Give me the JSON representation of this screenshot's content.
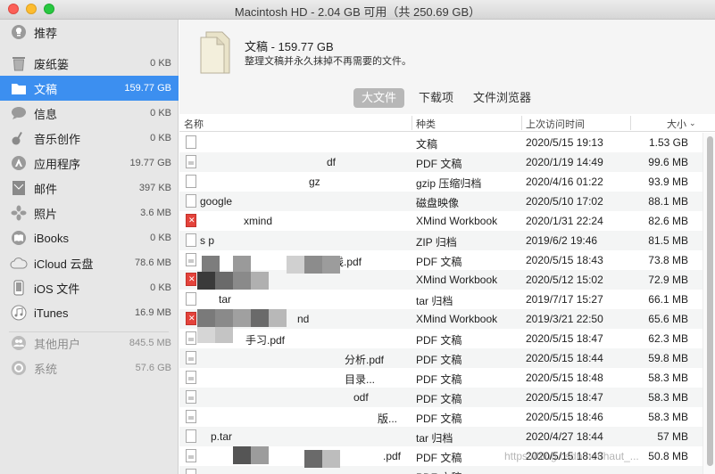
{
  "window": {
    "title": "Macintosh HD - 2.04 GB 可用（共 250.69 GB）"
  },
  "sidebar": {
    "items": [
      {
        "label": "推荐",
        "size": "",
        "icon": "lightbulb-icon"
      },
      {
        "label": "废纸篓",
        "size": "0 KB",
        "icon": "trash-icon"
      },
      {
        "label": "文稿",
        "size": "159.77 GB",
        "icon": "folder-icon",
        "selected": true
      },
      {
        "label": "信息",
        "size": "0 KB",
        "icon": "messages-icon"
      },
      {
        "label": "音乐创作",
        "size": "0 KB",
        "icon": "guitar-icon"
      },
      {
        "label": "应用程序",
        "size": "19.77 GB",
        "icon": "apps-icon"
      },
      {
        "label": "邮件",
        "size": "397 KB",
        "icon": "mail-icon"
      },
      {
        "label": "照片",
        "size": "3.6 MB",
        "icon": "photos-icon"
      },
      {
        "label": "iBooks",
        "size": "0 KB",
        "icon": "book-icon"
      },
      {
        "label": "iCloud 云盘",
        "size": "78.6 MB",
        "icon": "cloud-icon"
      },
      {
        "label": "iOS 文件",
        "size": "0 KB",
        "icon": "phone-icon"
      },
      {
        "label": "iTunes",
        "size": "16.9 MB",
        "icon": "music-icon"
      },
      {
        "label": "其他用户",
        "size": "845.5 MB",
        "icon": "users-icon",
        "dim": true
      },
      {
        "label": "系统",
        "size": "57.6 GB",
        "icon": "gear-icon",
        "dim": true
      }
    ]
  },
  "header": {
    "title": "文稿 - 159.77 GB",
    "description": "整理文稿并永久抹掉不再需要的文件。"
  },
  "tabs": [
    {
      "label": "大文件",
      "active": true
    },
    {
      "label": "下载项",
      "active": false
    },
    {
      "label": "文件浏览器",
      "active": false
    }
  ],
  "columns": {
    "name": "名称",
    "kind": "种类",
    "last_opened": "上次访问时间",
    "size": "大小"
  },
  "files": [
    {
      "name": "",
      "kind": "文稿",
      "date": "2020/5/15 19:13",
      "size": "1.53 GB",
      "icon": "doc"
    },
    {
      "name": "df",
      "kind": "PDF 文稿",
      "date": "2020/1/19 14:49",
      "size": "99.6 MB",
      "icon": "pdf"
    },
    {
      "name": "gz",
      "kind": "gzip 压缩归档",
      "date": "2020/4/16 01:22",
      "size": "93.9 MB",
      "icon": "doc"
    },
    {
      "name": "google",
      "kind": "磁盘映像",
      "date": "2020/5/10 17:02",
      "size": "88.1 MB",
      "icon": "doc"
    },
    {
      "name": "xmind",
      "kind": "XMind Workbook",
      "date": "2020/1/31 22:24",
      "size": "82.6 MB",
      "icon": "xmind"
    },
    {
      "name": "s p",
      "kind": "ZIP 归档",
      "date": "2019/6/2 19:46",
      "size": "81.5 MB",
      "icon": "doc"
    },
    {
      "name": "践.pdf",
      "kind": "PDF 文稿",
      "date": "2020/5/15 18:43",
      "size": "73.8 MB",
      "icon": "pdf"
    },
    {
      "name": "",
      "kind": "XMind Workbook",
      "date": "2020/5/12 15:02",
      "size": "72.9 MB",
      "icon": "xmind"
    },
    {
      "name": "tar",
      "kind": "tar 归档",
      "date": "2019/7/17 15:27",
      "size": "66.1 MB",
      "icon": "doc"
    },
    {
      "name": "nd",
      "kind": "XMind Workbook",
      "date": "2019/3/21 22:50",
      "size": "65.6 MB",
      "icon": "xmind"
    },
    {
      "name": "手习.pdf",
      "kind": "PDF 文稿",
      "date": "2020/5/15 18:47",
      "size": "62.3 MB",
      "icon": "pdf"
    },
    {
      "name": "分析.pdf",
      "kind": "PDF 文稿",
      "date": "2020/5/15 18:44",
      "size": "59.8 MB",
      "icon": "pdf"
    },
    {
      "name": "目录...",
      "kind": "PDF 文稿",
      "date": "2020/5/15 18:48",
      "size": "58.3 MB",
      "icon": "pdf"
    },
    {
      "name": "odf",
      "kind": "PDF 文稿",
      "date": "2020/5/15 18:47",
      "size": "58.3 MB",
      "icon": "pdf"
    },
    {
      "name": "版...",
      "kind": "PDF 文稿",
      "date": "2020/5/15 18:46",
      "size": "58.3 MB",
      "icon": "pdf"
    },
    {
      "name": "p.tar",
      "kind": "tar 归档",
      "date": "2020/4/27 18:44",
      "size": "57 MB",
      "icon": "doc"
    },
    {
      "name": ".pdf",
      "kind": "PDF 文稿",
      "date": "2020/5/15 18:43",
      "size": "50.8 MB",
      "icon": "pdf"
    },
    {
      "name": "",
      "kind": "PDF 文稿",
      "date": "",
      "size": "",
      "icon": "pdf"
    }
  ],
  "watermark": "https://blog.csdn.net/haut_..."
}
